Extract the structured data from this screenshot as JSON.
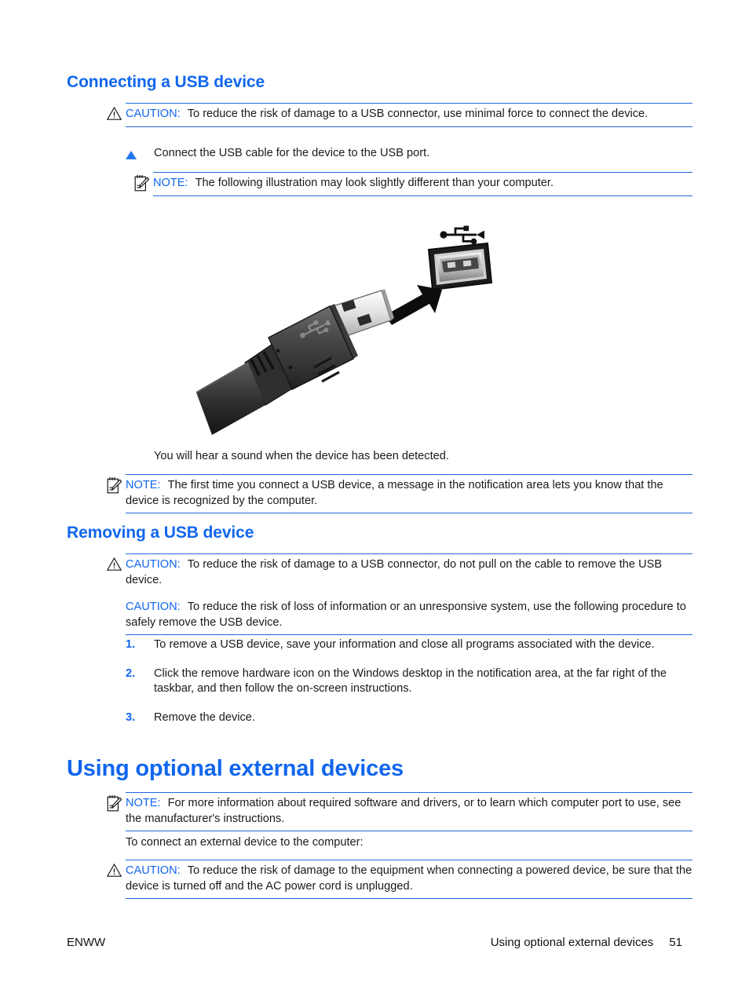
{
  "page": {
    "number": "51",
    "footer_left": "ENWW",
    "footer_right_title": "Using optional external devices"
  },
  "colors": {
    "heading_blue": "#1166ee",
    "rule_blue": "#2266dd",
    "keyword_blue": "#1166ee",
    "body_text": "#1a1a1a"
  },
  "sections": {
    "connecting": {
      "heading": "Connecting a USB device",
      "caution_1": {
        "label": "CAUTION:",
        "text": "To reduce the risk of damage to a USB connector, use minimal force to connect the device.",
        "icon": "caution-triangle-icon"
      },
      "step": {
        "marker": "triangle-bullet-icon",
        "text": "Connect the USB cable for the device to the USB port."
      },
      "note_1": {
        "label": "NOTE:",
        "text": "The following illustration may look slightly different than your computer.",
        "icon": "note-pad-icon"
      },
      "figure": {
        "alt": "USB cable connector being inserted into a USB port on a computer",
        "name": "usb-connection-illustration"
      },
      "after_figure_text": "You will hear a sound when the device has been detected.",
      "note_2": {
        "label": "NOTE:",
        "text": "The first time you connect a USB device, a message in the notification area lets you know that the device is recognized by the computer.",
        "icon": "note-pad-icon"
      }
    },
    "removing": {
      "heading": "Removing a USB device",
      "caution_1": {
        "label": "CAUTION:",
        "text": "To reduce the risk of damage to a USB connector, do not pull on the cable to remove the USB device.",
        "icon": "caution-triangle-icon"
      },
      "caution_2": {
        "label": "CAUTION:",
        "text": "To reduce the risk of loss of information or an unresponsive system, use the following procedure to safely remove the USB device."
      },
      "steps": [
        {
          "number": "1.",
          "text": "To remove a USB device, save your information and close all programs associated with the device."
        },
        {
          "number": "2.",
          "text": "Click the remove hardware icon on the Windows desktop in the notification area, at the far right of the taskbar, and then follow the on-screen instructions."
        },
        {
          "number": "3.",
          "text": "Remove the device."
        }
      ]
    },
    "using_external": {
      "heading": "Using optional external devices",
      "note_1": {
        "label": "NOTE:",
        "text": "For more information about required software and drivers, or to learn which computer port to use, see the manufacturer's instructions.",
        "icon": "note-pad-icon"
      },
      "intro": "To connect an external device to the computer:",
      "caution_1": {
        "label": "CAUTION:",
        "text": "To reduce the risk of damage to the equipment when connecting a powered device, be sure that the device is turned off and the AC power cord is unplugged.",
        "icon": "caution-triangle-icon"
      }
    }
  }
}
